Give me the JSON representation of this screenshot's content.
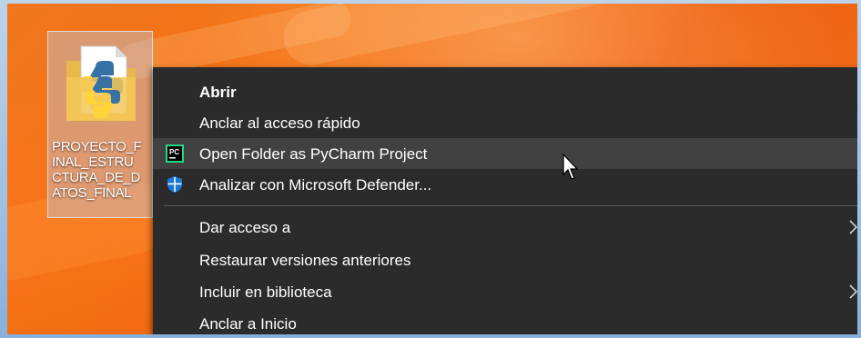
{
  "desktop": {
    "folder_name": "PROYECTO_F\nINAL_ESTRU\nCTURA_DE_D\nATOS_FINAL"
  },
  "context_menu": {
    "items": [
      {
        "label": "Abrir",
        "bold": true
      },
      {
        "label": "Anclar al acceso rápido"
      },
      {
        "label": "Open Folder as PyCharm Project",
        "icon": "pycharm-icon",
        "hovered": true
      },
      {
        "label": "Analizar con Microsoft Defender...",
        "icon": "defender-shield-icon"
      },
      {
        "label": "Dar acceso a",
        "submenu": true
      },
      {
        "label": "Restaurar versiones anteriores"
      },
      {
        "label": "Incluir en biblioteca",
        "submenu": true
      },
      {
        "label": "Anclar a Inicio"
      }
    ]
  },
  "colors": {
    "menu_background": "#2b2b2b",
    "menu_hover": "#414141",
    "wallpaper_accent": "#f46f12",
    "defender_blue": "#1a78d4"
  }
}
